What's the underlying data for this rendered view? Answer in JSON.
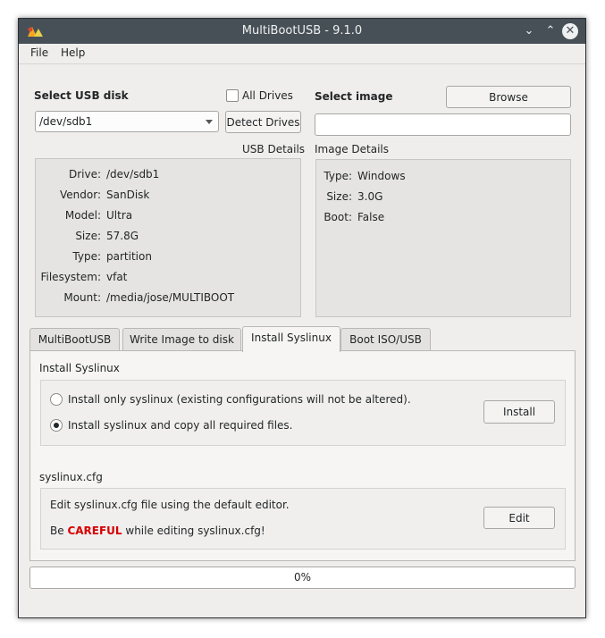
{
  "window": {
    "title": "MultiBootUSB - 9.1.0",
    "controls": {
      "minimize": "⌄",
      "maximize": "⌃",
      "close": "✕"
    }
  },
  "menu": {
    "file": "File",
    "help": "Help"
  },
  "usb": {
    "select_label": "Select USB disk",
    "all_drives_label": "All Drives",
    "all_drives_checked": false,
    "selected_disk": "/dev/sdb1",
    "detect_button": "Detect Drives",
    "details_label": "USB Details",
    "details": [
      {
        "key": "Drive:",
        "value": "/dev/sdb1"
      },
      {
        "key": "Vendor:",
        "value": "SanDisk"
      },
      {
        "key": "Model:",
        "value": "Ultra"
      },
      {
        "key": "Size:",
        "value": "57.8G"
      },
      {
        "key": "Type:",
        "value": "partition"
      },
      {
        "key": "Filesystem:",
        "value": "vfat"
      },
      {
        "key": "Mount:",
        "value": "/media/jose/MULTIBOOT"
      }
    ]
  },
  "image": {
    "select_label": "Select image",
    "browse_button": "Browse",
    "path_value": "",
    "details_label": "Image Details",
    "details": [
      {
        "key": "Type:",
        "value": "Windows"
      },
      {
        "key": "Size:",
        "value": "3.0G"
      },
      {
        "key": "Boot:",
        "value": "False"
      }
    ]
  },
  "tabs": [
    {
      "label": "MultiBootUSB",
      "active": false
    },
    {
      "label": "Write Image to disk",
      "active": false
    },
    {
      "label": "Install Syslinux",
      "active": true
    },
    {
      "label": "Boot ISO/USB",
      "active": false
    }
  ],
  "syslinux": {
    "section_title": "Install Syslinux",
    "option_only": "Install only syslinux (existing configurations will not be altered).",
    "option_copy": "Install syslinux and copy all required files.",
    "selected_option": "copy",
    "install_button": "Install",
    "cfg_title": "syslinux.cfg",
    "cfg_desc": "Edit syslinux.cfg file using the default editor.",
    "warn_prefix": "Be ",
    "warn_emphasis": "CAREFUL",
    "warn_suffix": " while editing syslinux.cfg!",
    "edit_button": "Edit"
  },
  "progress": {
    "value": 0,
    "text": "0%"
  },
  "colors": {
    "titlebar": "#475057",
    "accent": "#3daee9",
    "warning": "#d60000"
  }
}
